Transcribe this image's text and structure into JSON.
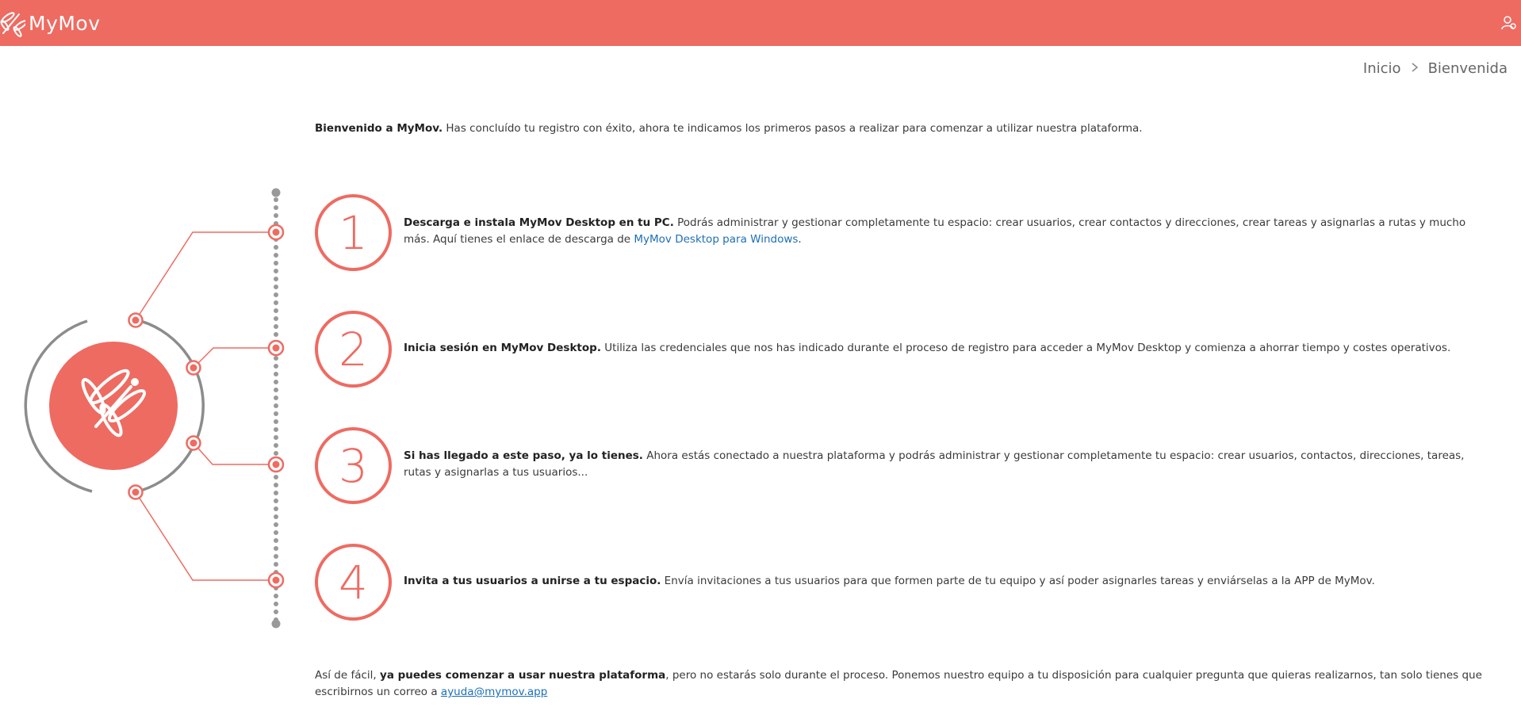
{
  "app": {
    "name": "MyMov",
    "logo_icon": "dragonfly-icon",
    "user_icon": "user-icon"
  },
  "colors": {
    "brand": "#ee6b62",
    "link": "#1c6fb5",
    "text": "#3a3a3a",
    "diagram_gray": "#8c8c8c"
  },
  "breadcrumb": {
    "home": "Inicio",
    "separator_icon": "chevron-right-icon",
    "current": "Bienvenida"
  },
  "intro": {
    "bold": "Bienvenido a MyMov.",
    "text": " Has concluído tu registro con éxito, ahora te indicamos los primeros pasos a realizar para comenzar a utilizar nuestra plataforma."
  },
  "steps": [
    {
      "number": "1",
      "bold": "Descarga e instala MyMov Desktop en tu PC.",
      "text": " Podrás administrar y gestionar completamente tu espacio: crear usuarios, crear contactos y direcciones, crear tareas y asignarlas a rutas y mucho más. Aquí tienes el enlace de descarga de ",
      "link": "MyMov Desktop para Windows",
      "after": "."
    },
    {
      "number": "2",
      "bold": "Inicia sesión en MyMov Desktop.",
      "text": " Utiliza las credenciales que nos has indicado durante el proceso de registro para acceder a MyMov Desktop y comienza a ahorrar tiempo y costes operativos."
    },
    {
      "number": "3",
      "bold": "Si has llegado a este paso, ya lo tienes.",
      "text": " Ahora estás conectado a nuestra plataforma y podrás administrar y gestionar completamente tu espacio: crear usuarios, contactos, direcciones, tareas, rutas y asignarlas a tus usuarios..."
    },
    {
      "number": "4",
      "bold": "Invita a tus usuarios a unirse a tu espacio.",
      "text": " Envía invitaciones a tus usuarios para que formen parte de tu equipo y así poder asignarles tareas y enviárselas a la APP de MyMov."
    }
  ],
  "outro": {
    "pre": "Así de fácil, ",
    "bold": "ya puedes comenzar a usar nuestra plataforma",
    "text": ", pero no estarás solo durante el proceso. Ponemos nuestro equipo a tu disposición para cualquier pregunta que quieras realizarnos, tan solo tienes que escribirnos un correo a ",
    "email": "ayuda@mymov.app"
  }
}
